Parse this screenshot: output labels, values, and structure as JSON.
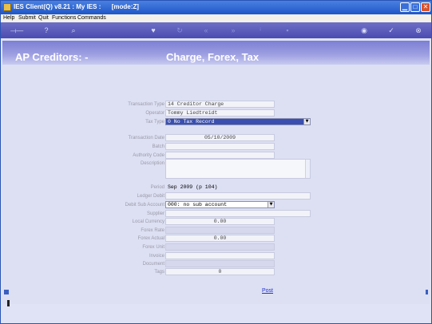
{
  "window": {
    "title": "IES Client(Q) v8.21 : My IES :      [mode:Z]"
  },
  "menu": [
    "Help",
    "Submit",
    "Quit",
    "Functions",
    "Commands"
  ],
  "header": {
    "left_title": "AP Creditors: -",
    "right_title": "Charge, Forex, Tax"
  },
  "form": {
    "labels": {
      "transaction_type": "Transaction Type",
      "operator": "Operator",
      "tax_type": "Tax Type",
      "transaction_date": "Transaction Date",
      "batch": "Batch",
      "authority_code": "Authority Code",
      "description": "Description",
      "period": "Period",
      "ledger_debit": "Ledger Debit",
      "debit_sub_account": "Debit Sub Account",
      "supplier": "Supplier",
      "local_currency": "Local Currency",
      "forex_rate": "Forex Rate",
      "forex_actual": "Forex Actual",
      "forex_unit": "Forex Unit",
      "invoice": "Invoice",
      "document": "Document",
      "tags": "Tags"
    },
    "values": {
      "transaction_type": "14 Creditor Charge",
      "operator": "Tommy Liedtreidt",
      "tax_type": "0 No Tax Record",
      "transaction_date": "05/10/2009",
      "period": "Sep 2009 (p 104)",
      "debit_sub_account": "000: no sub account",
      "local_currency": "0.00",
      "forex_actual": "0.00",
      "tags": "0"
    }
  },
  "actions": {
    "post_label": "Post"
  },
  "colors": {
    "title_bar": "#1e56c8",
    "toolbar": "#4a4bb0",
    "header_band": "#8f91dc",
    "content_bg": "#dde0f3",
    "link": "#2233cc"
  },
  "icons": {
    "toolbar": [
      "exit-arrow-icon",
      "help-icon",
      "search-icon",
      "heart-icon",
      "refresh-icon",
      "rewind-icon",
      "fast-forward-icon",
      "info-icon",
      "save-icon",
      "globe-icon",
      "checkmark-icon",
      "close-icon"
    ]
  }
}
